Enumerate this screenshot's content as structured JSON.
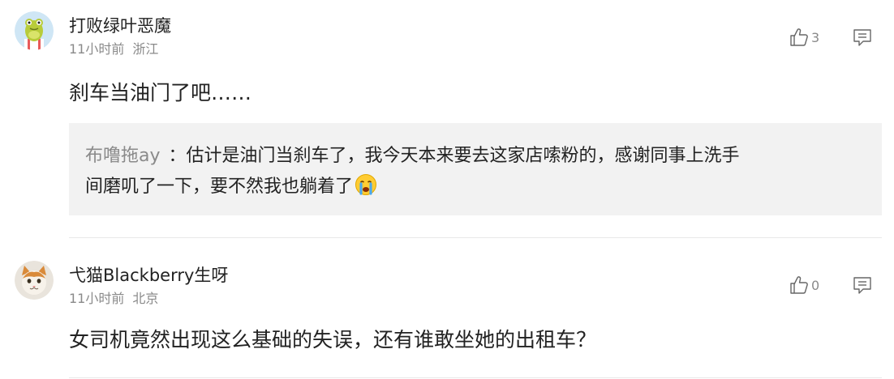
{
  "comments": [
    {
      "username": "打败绿叶恶魔",
      "time": "11小时前",
      "location": "浙江",
      "likes": "3",
      "text": "刹车当油门了吧……",
      "avatar_icon": "frog-character-avatar",
      "quoted_reply": {
        "author": "布噜拖ay",
        "separator": "：",
        "line1": "估计是油门当刹车了，我今天本来要去这家店嗦粉的，感谢同事上洗手",
        "line2": "间磨叽了一下，要不然我也躺着了",
        "emoji_icon": "crying-face-icon"
      }
    },
    {
      "username": "弋猫Blackberry生呀",
      "time": "11小时前",
      "location": "北京",
      "likes": "0",
      "text": "女司机竟然出现这么基础的失误，还有谁敢坐她的出租车？",
      "avatar_icon": "cat-avatar"
    }
  ],
  "colors": {
    "meta_gray": "#8a8a8a",
    "quote_bg": "#f2f2f2",
    "divider": "#e8e8e8"
  }
}
